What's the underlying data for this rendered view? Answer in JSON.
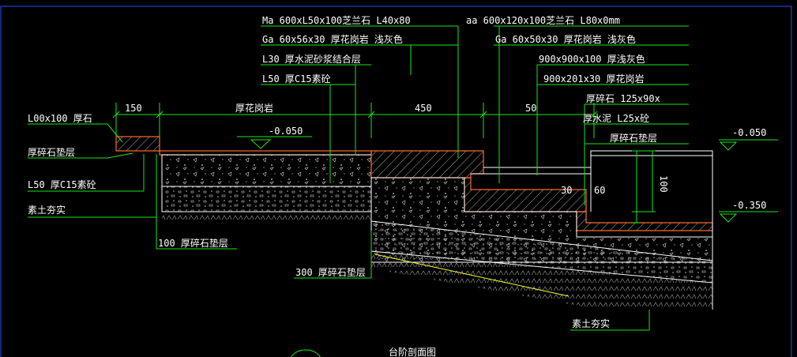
{
  "drawing": {
    "colors": {
      "background": "#000000",
      "leader_lines": "#19e619",
      "outlines": "#ffffff",
      "paving_edges": "#ff6a33",
      "ground_line": "#ffff33",
      "frame_border": "#2b4cff"
    },
    "notes": {
      "top_1": "Ma 600xL50x100芝兰石 L40x80",
      "top_2": "aa 600x120x100芝兰石 L80x0mm",
      "stone_a": "Ga 60x56x30 厚花岗岩 浅灰色",
      "stone_b": "Ga 60x50x30 厚花岗岩 浅灰色",
      "mortar_a": "L30 厚水泥砂浆结合层",
      "concrete_a": "L50 厚C15素砼",
      "spec_900a": "900x900x100 厚浅灰色",
      "spec_900b": "900x201x30 厚花岗岩",
      "base_a": "厚碎石 125x90x",
      "base_b": "厚水泥 L25x砼",
      "base_c": "厚碎石垫层",
      "left_1": "L00x100 厚石",
      "left_2": "厚碎石垫层",
      "left_3": "L50 厚C15素砼",
      "left_4": "素土夯实",
      "bottom_mid": "100 厚碎石垫层",
      "bottom_left": "300 厚碎石垫层",
      "bottom_right": "素土夯实",
      "title": "台阶剖面图"
    },
    "dimensions": {
      "d_150": "150",
      "d_mid": "厚花岗岩",
      "d_450": "450",
      "d_50": "50",
      "d_30": "30",
      "d_60": "60",
      "d_100": "100"
    },
    "levels": {
      "lvl_left": "-0.050",
      "lvl_right_top": "-0.050",
      "lvl_right_bottom": "-0.350"
    }
  }
}
